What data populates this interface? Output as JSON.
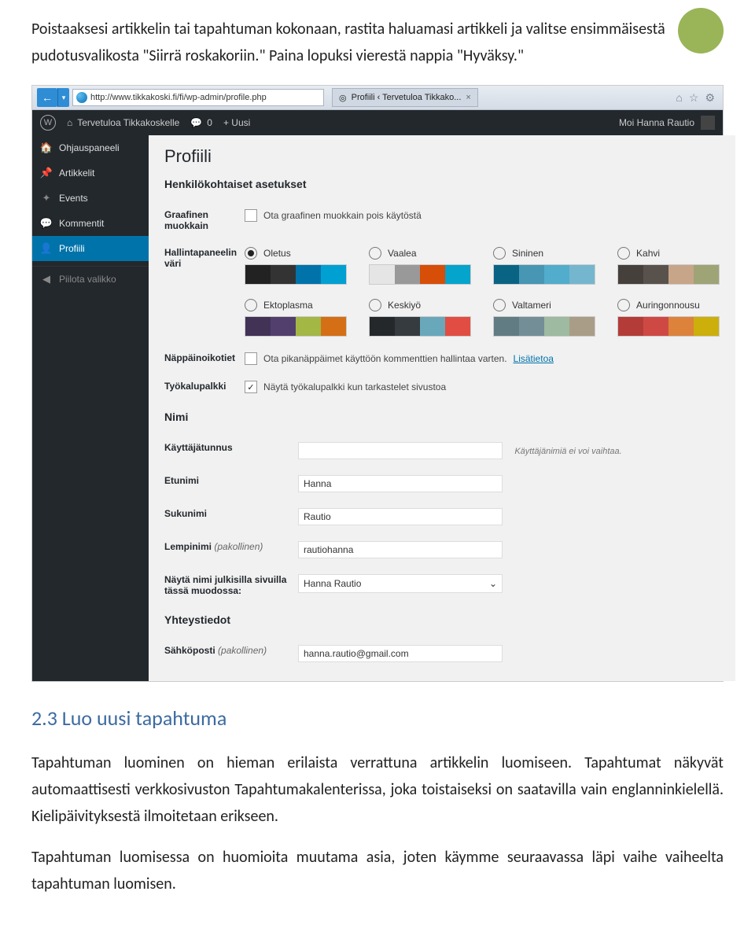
{
  "doc": {
    "intro": "Poistaaksesi artikkelin tai tapahtuman kokonaan, rastita haluamasi artikkeli ja valitse ensimmäisestä pudotusvalikosta \"Siirrä roskakoriin.\" Paina lopuksi vierestä nappia \"Hyväksy.\"",
    "heading": "2.3 Luo uusi tapahtuma",
    "p1": "Tapahtuman luominen on hieman erilaista verrattuna artikkelin luomiseen. Tapahtumat näkyvät automaattisesti verkkosivuston Tapahtumakalenterissa, joka toistaiseksi on saatavilla vain englanninkielellä. Kielipäivityksestä ilmoitetaan erikseen.",
    "p2": "Tapahtuman luomisessa on huomioita muutama asia, joten käymme seuraavassa läpi vaihe vaiheelta tapahtuman luomisen."
  },
  "browser": {
    "url": "http://www.tikkakoski.fi/fi/wp-admin/profile.php",
    "tab_title": "Profiili ‹ Tervetuloa Tikkako...",
    "tab_close": "×",
    "icons": {
      "home": "⌂",
      "star": "☆",
      "gear": "⚙"
    }
  },
  "adminbar": {
    "wp": "W",
    "site_home_icon": "⌂",
    "site_name": "Tervetuloa Tikkakoskelle",
    "comments_icon": "💬",
    "comments_count": "0",
    "new_label": "+  Uusi",
    "greeting": "Moi Hanna Rautio"
  },
  "sidebar": {
    "items": [
      {
        "icon": "🏠",
        "label": "Ohjauspaneeli"
      },
      {
        "icon": "📌",
        "label": "Artikkelit"
      },
      {
        "icon": "✦",
        "label": "Events"
      },
      {
        "icon": "💬",
        "label": "Kommentit"
      },
      {
        "icon": "👤",
        "label": "Profiili"
      },
      {
        "icon": "◀",
        "label": "Piilota valikko"
      }
    ]
  },
  "profile": {
    "title": "Profiili",
    "section_personal": "Henkilökohtaiset asetukset",
    "row_visual_editor": "Graafinen muokkain",
    "visual_editor_cb": "Ota graafinen muokkain pois käytöstä",
    "row_color": "Hallintapaneelin väri",
    "schemes": [
      {
        "name": "Oletus",
        "colors": [
          "#222222",
          "#333333",
          "#0073aa",
          "#00a0d2"
        ],
        "selected": true
      },
      {
        "name": "Vaalea",
        "colors": [
          "#e5e5e5",
          "#999999",
          "#d64e07",
          "#04a4cc"
        ],
        "selected": false
      },
      {
        "name": "Sininen",
        "colors": [
          "#096484",
          "#4796b3",
          "#52accc",
          "#74B6CE"
        ],
        "selected": false
      },
      {
        "name": "Kahvi",
        "colors": [
          "#46403c",
          "#59524c",
          "#c7a589",
          "#9ea476"
        ],
        "selected": false
      },
      {
        "name": "Ektoplasma",
        "colors": [
          "#413256",
          "#523f6d",
          "#a3b745",
          "#d46f15"
        ],
        "selected": false
      },
      {
        "name": "Keskiyö",
        "colors": [
          "#25282b",
          "#363b3f",
          "#69a8bb",
          "#e14d43"
        ],
        "selected": false
      },
      {
        "name": "Valtameri",
        "colors": [
          "#627c83",
          "#738e96",
          "#9ebaa0",
          "#aa9d88"
        ],
        "selected": false
      },
      {
        "name": "Auringonnousu",
        "colors": [
          "#b43c38",
          "#cf4944",
          "#dd823b",
          "#ccaf0b"
        ],
        "selected": false
      }
    ],
    "row_shortcuts": "Näppäinoikotiet",
    "shortcuts_cb": "Ota pikanäppäimet käyttöön kommenttien hallintaa varten.",
    "shortcuts_link": "Lisätietoa",
    "row_toolbar": "Työkalupalkki",
    "toolbar_cb": "Näytä työkalupalkki kun tarkastelet sivustoa",
    "section_name": "Nimi",
    "row_username": "Käyttäjätunnus",
    "username_value": "",
    "username_hint": "Käyttäjänimiä ei voi vaihtaa.",
    "row_firstname": "Etunimi",
    "firstname_value": "Hanna",
    "row_lastname": "Sukunimi",
    "lastname_value": "Rautio",
    "row_nickname": "Lempinimi",
    "nickname_req": "(pakollinen)",
    "nickname_value": "rautiohanna",
    "row_displayname": "Näytä nimi julkisilla sivuilla tässä muodossa:",
    "displayname_value": "Hanna Rautio",
    "section_contact": "Yhteystiedot",
    "row_email": "Sähköposti",
    "email_req": "(pakollinen)",
    "email_value": "hanna.rautio@gmail.com"
  }
}
